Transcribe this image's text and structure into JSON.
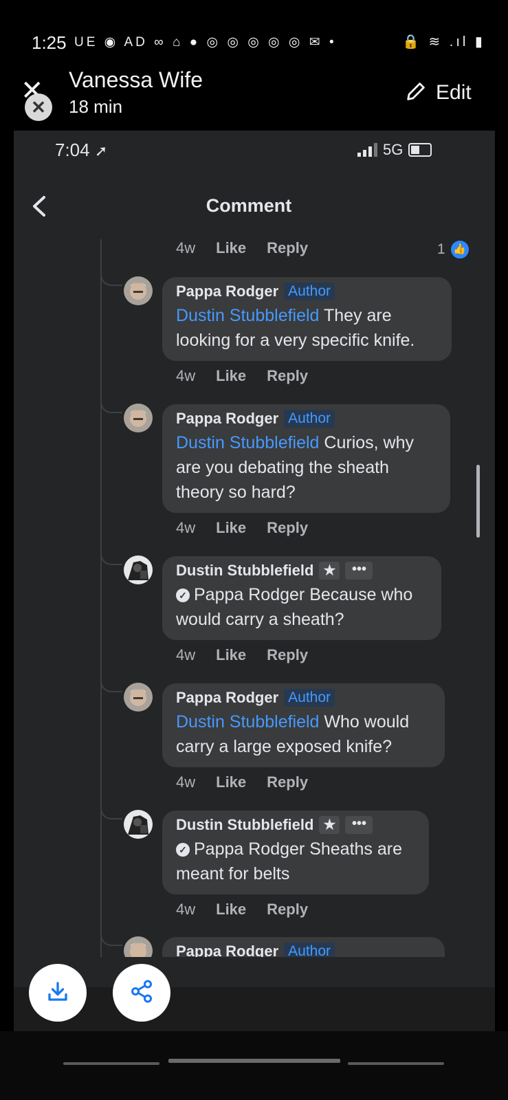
{
  "outer_status": {
    "time": "1:25",
    "icons_left": "UE ◉ AD ∞ ⌂ ● ◎ ◎ ◎ ◎ ◎ ✉ •",
    "icons_right": "🔒 ≋ .ıl ▮"
  },
  "outer_header": {
    "contact_name": "Vanessa Wife",
    "elapsed": "18 min",
    "edit_label": "Edit"
  },
  "inner_status": {
    "time": "7:04",
    "network": "5G"
  },
  "screen": {
    "title": "Comment"
  },
  "top_meta": {
    "age": "4w",
    "like": "Like",
    "reply": "Reply",
    "reaction_count": "1"
  },
  "comments": [
    {
      "author": "Pappa Rodger",
      "tag": "Author",
      "mention": "Dustin Stubblefield",
      "text_lines": [
        "They are",
        "looking for a very specific knife."
      ],
      "age": "4w",
      "like": "Like",
      "reply": "Reply"
    },
    {
      "author": "Pappa Rodger",
      "tag": "Author",
      "mention": "Dustin Stubblefield",
      "text_lines": [
        "Curios, why",
        "are you debating the sheath",
        "theory so hard?"
      ],
      "age": "4w",
      "like": "Like",
      "reply": "Reply"
    },
    {
      "author": "Dustin Stubblefield",
      "mention": "Pappa Rodger",
      "text_lines": [
        "Because who",
        "would carry a sheath?"
      ],
      "age": "4w",
      "like": "Like",
      "reply": "Reply"
    },
    {
      "author": "Pappa Rodger",
      "tag": "Author",
      "mention": "Dustin Stubblefield",
      "text_lines": [
        "Who would",
        "carry a large exposed knife?"
      ],
      "age": "4w",
      "like": "Like",
      "reply": "Reply"
    },
    {
      "author": "Dustin Stubblefield",
      "mention": "Pappa Rodger",
      "text_lines": [
        "Sheaths are",
        "meant for belts"
      ],
      "age": "4w",
      "like": "Like",
      "reply": "Reply"
    },
    {
      "author": "Pappa Rodger",
      "tag": "Author"
    }
  ],
  "icons": {
    "download": "download-icon",
    "share": "share-icon",
    "back": "back-arrow-icon",
    "close": "close-icon",
    "edit": "pencil-icon",
    "star": "star-icon",
    "more": "more-icon",
    "thumb": "thumbs-up-icon"
  },
  "colors": {
    "background": "#242526",
    "bubble": "#3a3b3c",
    "link": "#4599ff",
    "like_badge": "#2d88ff"
  }
}
